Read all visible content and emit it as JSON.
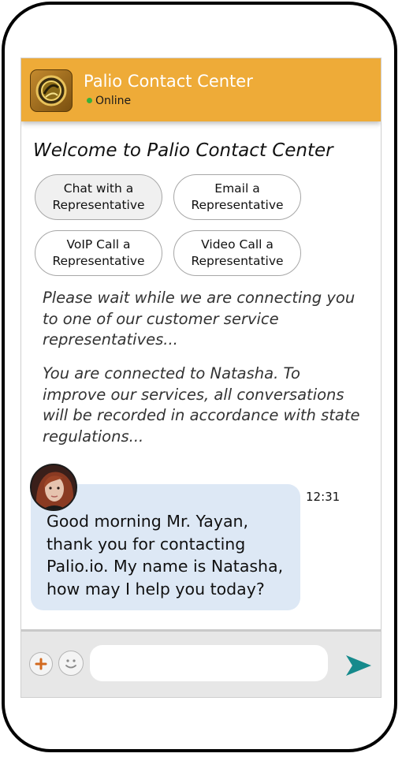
{
  "header": {
    "title": "Palio Contact Center",
    "status": "Online",
    "logo_icon": "palio-globe-logo",
    "bg_color": "#eeab38"
  },
  "welcome": "Welcome to Palio Contact Center",
  "options": [
    {
      "line1": "Chat with a",
      "line2": "Representative",
      "selected": true
    },
    {
      "line1": "Email a",
      "line2": "Representative",
      "selected": false
    },
    {
      "line1": "VoIP Call a",
      "line2": "Representative",
      "selected": false
    },
    {
      "line1": "Video Call a",
      "line2": "Representative",
      "selected": false
    }
  ],
  "system_messages": [
    "Please wait while we are connecting you to one of our customer service representatives...",
    "You are connected to Natasha. To improve our services, all conversations will be recorded in accordance with state regulations..."
  ],
  "agent_message": {
    "text": "Good morning Mr. Yayan, thank you for contacting Palio.io. My name is Natasha, how may I help you today?",
    "time": "12:31",
    "bubble_color": "#dde8f5"
  },
  "composer": {
    "placeholder": "",
    "attach_icon": "plus-icon",
    "emoji_icon": "smiley-icon",
    "send_icon": "send-arrow-icon",
    "send_color": "#168a8c"
  }
}
